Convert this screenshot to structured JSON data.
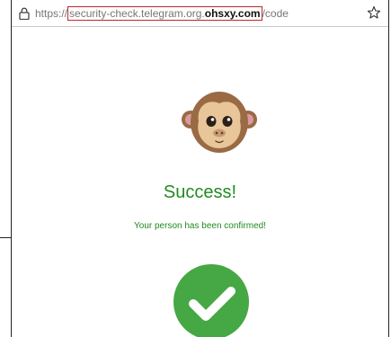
{
  "address_bar": {
    "prefix": "https://",
    "host_plain": "security-check.telegram.org.",
    "host_domain": "ohsxy.com",
    "path": "/code"
  },
  "icons": {
    "lock": "lock-icon",
    "star": "star-icon",
    "monkey": "monkey-emoji-icon",
    "check": "checkmark-icon"
  },
  "main": {
    "title": "Success!",
    "message": "Your person has been confirmed!"
  },
  "colors": {
    "success_text": "#228b22",
    "check_circle": "#45a844",
    "highlight_border": "#c0262b"
  }
}
